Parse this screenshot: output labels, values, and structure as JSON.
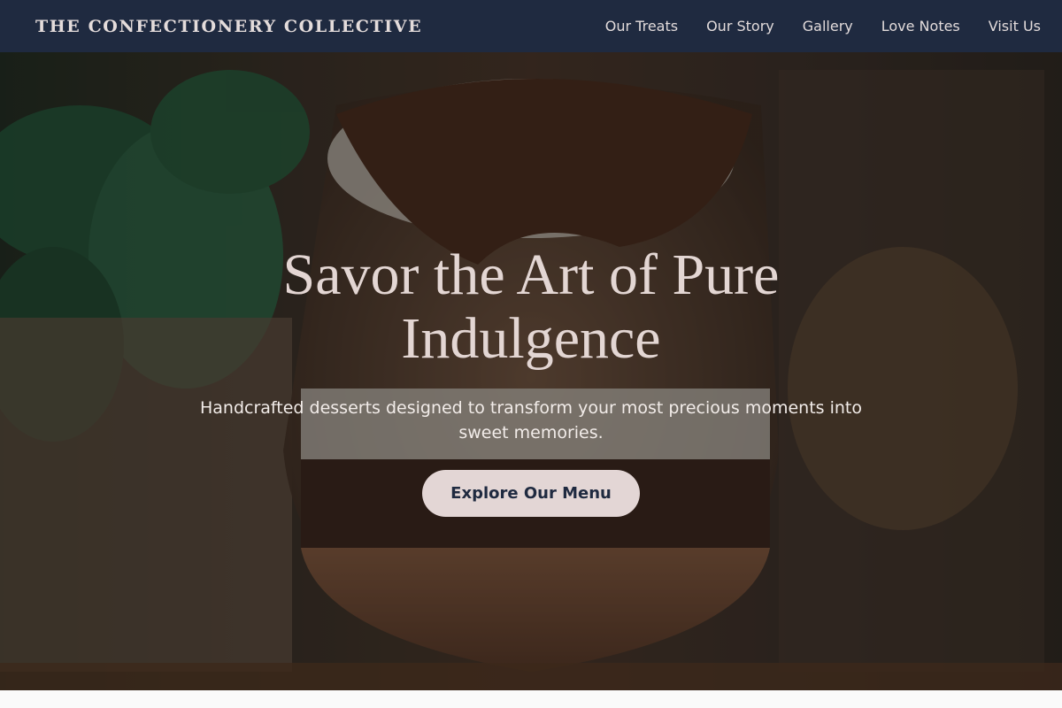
{
  "brand": {
    "name": "THE CONFECTIONERY COLLECTIVE"
  },
  "nav": {
    "items": [
      {
        "label": "Our Treats"
      },
      {
        "label": "Our Story"
      },
      {
        "label": "Gallery"
      },
      {
        "label": "Love Notes"
      },
      {
        "label": "Visit Us"
      }
    ]
  },
  "hero": {
    "title": "Savor the Art of Pure Indulgence",
    "subtitle": "Handcrafted desserts designed to transform your most precious moments into sweet memories.",
    "cta_label": "Explore Our Menu",
    "image_subject": "chocolate-parfait-dessert-photo"
  },
  "colors": {
    "nav_bg": "#1f2a40",
    "accent": "#e3d6d5",
    "text_light": "#e3d6d3"
  }
}
